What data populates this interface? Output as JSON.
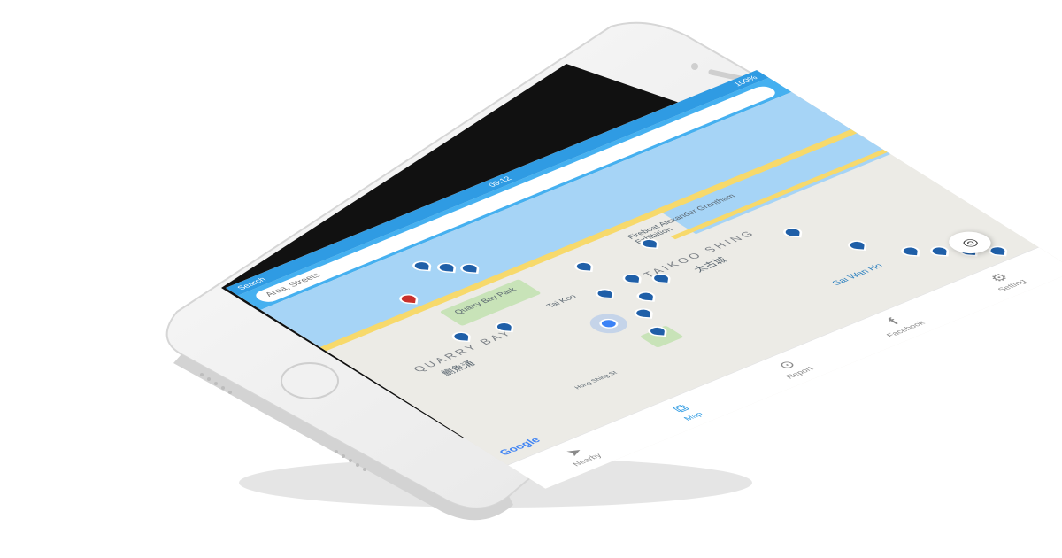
{
  "status": {
    "carrier": "Search",
    "time": "09:12",
    "battery": "100%"
  },
  "search": {
    "placeholder": "Area, Streets"
  },
  "map": {
    "labels": {
      "quarry_bay_en": "QUARRY BAY",
      "quarry_bay_zh": "鰂魚涌",
      "tai_koo_shing_en": "TAIKOO SHING",
      "tai_koo_shing_zh": "太古城",
      "quarry_bay_park": "Quarry Bay Park",
      "tai_koo": "Tai Koo",
      "sai_wan_ho": "Sai Wan Ho",
      "hong_shing_st": "Hong Shing St",
      "fireboat": "Fireboat Alexander Grantham Exhibition"
    },
    "brand": "Google"
  },
  "tabs": [
    {
      "label": "Nearby",
      "icon": "navigation-arrow-icon"
    },
    {
      "label": "Map",
      "icon": "map-icon",
      "active": true
    },
    {
      "label": "Report",
      "icon": "location-pin-icon"
    },
    {
      "label": "Facebook",
      "icon": "facebook-icon"
    },
    {
      "label": "Setting",
      "icon": "gear-icon"
    }
  ],
  "colors": {
    "accent": "#2f9be3",
    "pin_blue": "#1f5fa8",
    "pin_red": "#c9302c",
    "water": "#a6d4f6"
  }
}
